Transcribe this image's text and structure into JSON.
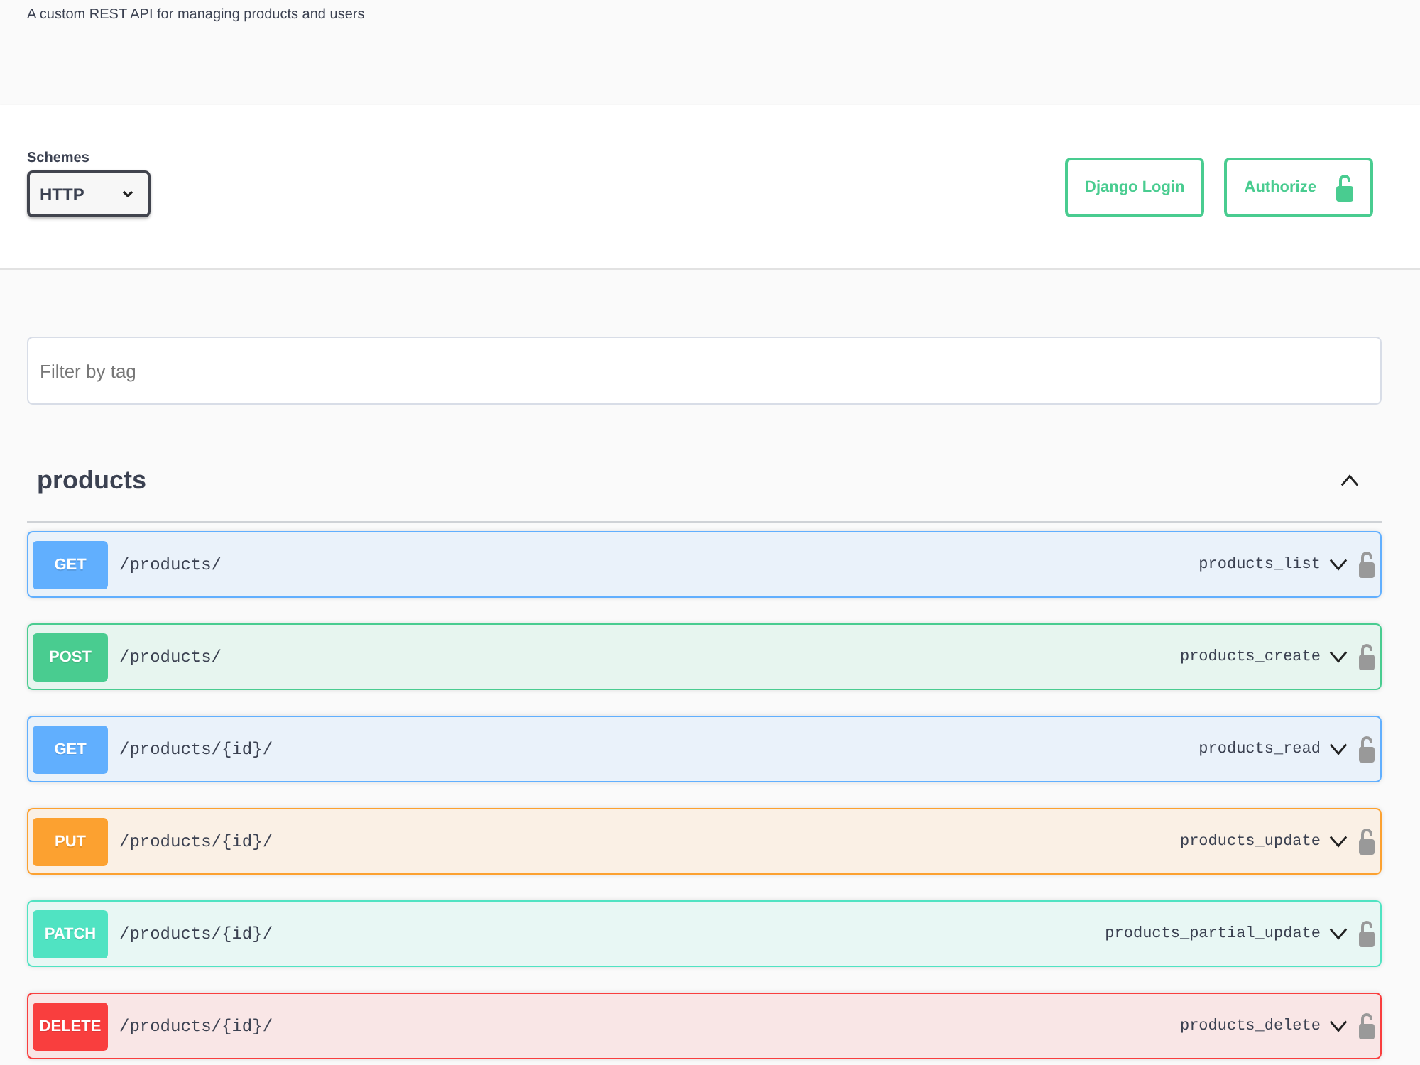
{
  "info": {
    "description": "A custom REST API for managing products and users"
  },
  "schemes": {
    "label": "Schemes",
    "value": "HTTP"
  },
  "auth_buttons": [
    {
      "label": "Django Login",
      "kind": "plain"
    },
    {
      "label": "Authorize",
      "kind": "lock"
    }
  ],
  "filter": {
    "placeholder": "Filter by tag"
  },
  "tags": [
    {
      "name": "products",
      "expanded": true,
      "operations": [
        {
          "method": "GET",
          "path": "/products/",
          "operation_id": "products_list",
          "color": "#61affe",
          "expanded": false
        },
        {
          "method": "POST",
          "path": "/products/",
          "operation_id": "products_create",
          "color": "#49cc90",
          "expanded": false
        },
        {
          "method": "GET",
          "path": "/products/{id}/",
          "operation_id": "products_read",
          "color": "#61affe",
          "expanded": false
        },
        {
          "method": "PUT",
          "path": "/products/{id}/",
          "operation_id": "products_update",
          "color": "#fca130",
          "expanded": false
        },
        {
          "method": "PATCH",
          "path": "/products/{id}/",
          "operation_id": "products_partial_update",
          "color": "#50e3c2",
          "expanded": false
        },
        {
          "method": "DELETE",
          "path": "/products/{id}/",
          "operation_id": "products_delete",
          "color": "#f93e3e",
          "expanded": false
        }
      ]
    }
  ]
}
